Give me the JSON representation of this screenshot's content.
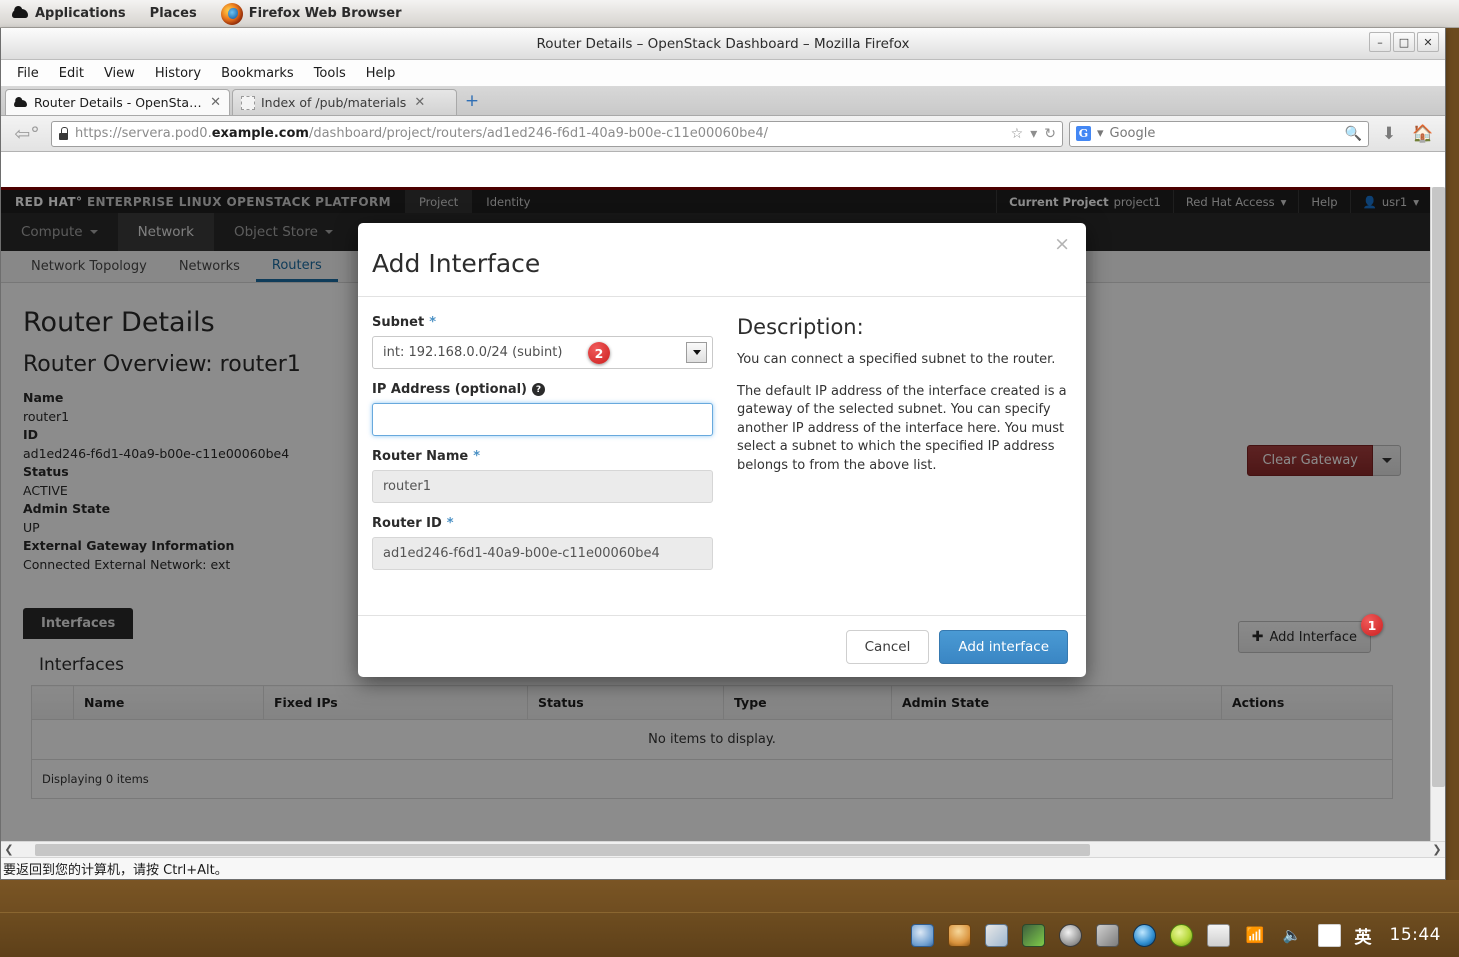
{
  "gnome_panel": {
    "applications": "Applications",
    "places": "Places",
    "active_window": "Firefox Web Browser"
  },
  "firefox": {
    "window_title": "Router Details – OpenStack Dashboard – Mozilla Firefox",
    "window_buttons": {
      "minimize": "–",
      "maximize": "□",
      "close": "✕"
    },
    "menus": [
      "File",
      "Edit",
      "View",
      "History",
      "Bookmarks",
      "Tools",
      "Help"
    ],
    "tabs": [
      {
        "label": "Router Details - OpenStack ...",
        "close": "✕",
        "active": true
      },
      {
        "label": "Index of /pub/materials",
        "close": "✕",
        "active": false
      }
    ],
    "new_tab_label": "+",
    "url": {
      "scheme": "https://servera.pod0.",
      "domain": "example.com",
      "path": "/dashboard/project/routers/ad1ed246-f6d1-40a9-b00e-c11e00060be4/"
    },
    "search": {
      "engine": "G",
      "placeholder": "Google",
      "value": "Google"
    },
    "status_text": "要返回到您的计算机，请按 Ctrl+Alt。"
  },
  "openstack": {
    "brand_prefix": "RED HAT",
    "brand_suffix": "ENTERPRISE LINUX OPENSTACK PLATFORM",
    "top_tabs": [
      {
        "label": "Project",
        "active": true
      },
      {
        "label": "Identity",
        "active": false
      }
    ],
    "top_right": {
      "current_project_label": "Current Project",
      "current_project_value": "project1",
      "red_hat_access": "Red Hat Access",
      "help": "Help",
      "user": "usr1"
    },
    "nav2": [
      {
        "label": "Compute",
        "caret": true,
        "active": false
      },
      {
        "label": "Network",
        "caret": false,
        "active": true
      },
      {
        "label": "Object Store",
        "caret": true,
        "active": false
      }
    ],
    "subnav": [
      {
        "label": "Network Topology",
        "active": false
      },
      {
        "label": "Networks",
        "active": false
      },
      {
        "label": "Routers",
        "active": true
      }
    ],
    "page_title": "Router Details",
    "overview_title": "Router Overview: router1",
    "overview_fields": [
      {
        "key": "Name",
        "value": "router1"
      },
      {
        "key": "ID",
        "value": "ad1ed246-f6d1-40a9-b00e-c11e00060be4"
      },
      {
        "key": "Status",
        "value": "ACTIVE"
      },
      {
        "key": "Admin State",
        "value": "UP"
      },
      {
        "key": "External Gateway Information",
        "value": "Connected External Network: ext"
      }
    ],
    "clear_gateway_button": "Clear Gateway",
    "interfaces_tab_label": "Interfaces",
    "interfaces_section_title": "Interfaces",
    "add_interface_button": "Add Interface",
    "table": {
      "columns": [
        "",
        "Name",
        "Fixed IPs",
        "Status",
        "Type",
        "Admin State",
        "Actions"
      ],
      "empty_message": "No items to display.",
      "footer": "Displaying 0 items"
    }
  },
  "modal": {
    "title": "Add Interface",
    "close_label": "×",
    "fields": {
      "subnet": {
        "label": "Subnet",
        "required_marker": "*",
        "value": "int: 192.168.0.0/24 (subint)"
      },
      "ip_address": {
        "label": "IP Address (optional)",
        "help_marker": "?",
        "value": "",
        "placeholder": ""
      },
      "router_name": {
        "label": "Router Name",
        "required_marker": "*",
        "value": "router1"
      },
      "router_id": {
        "label": "Router ID",
        "required_marker": "*",
        "value": "ad1ed246-f6d1-40a9-b00e-c11e00060be4"
      }
    },
    "description": {
      "title": "Description:",
      "paragraphs": [
        "You can connect a specified subnet to the router.",
        "The default IP address of the interface created is a gateway of the selected subnet. You can specify another IP address of the interface here. You must select a subnet to which the specified IP address belongs to from the above list."
      ]
    },
    "buttons": {
      "cancel": "Cancel",
      "submit": "Add interface"
    }
  },
  "annotations": [
    {
      "number": "1",
      "target": "add-interface-button"
    },
    {
      "number": "2",
      "target": "subnet-select"
    }
  ],
  "taskbar": {
    "language": "英",
    "clock": "15:44"
  },
  "colors": {
    "brand_red": "#8b0000",
    "primary_blue": "#3a86c4",
    "danger_red": "#8d2a2a",
    "badge_red": "#cc1f1f",
    "desktop_brown": "#6b4a1f"
  }
}
